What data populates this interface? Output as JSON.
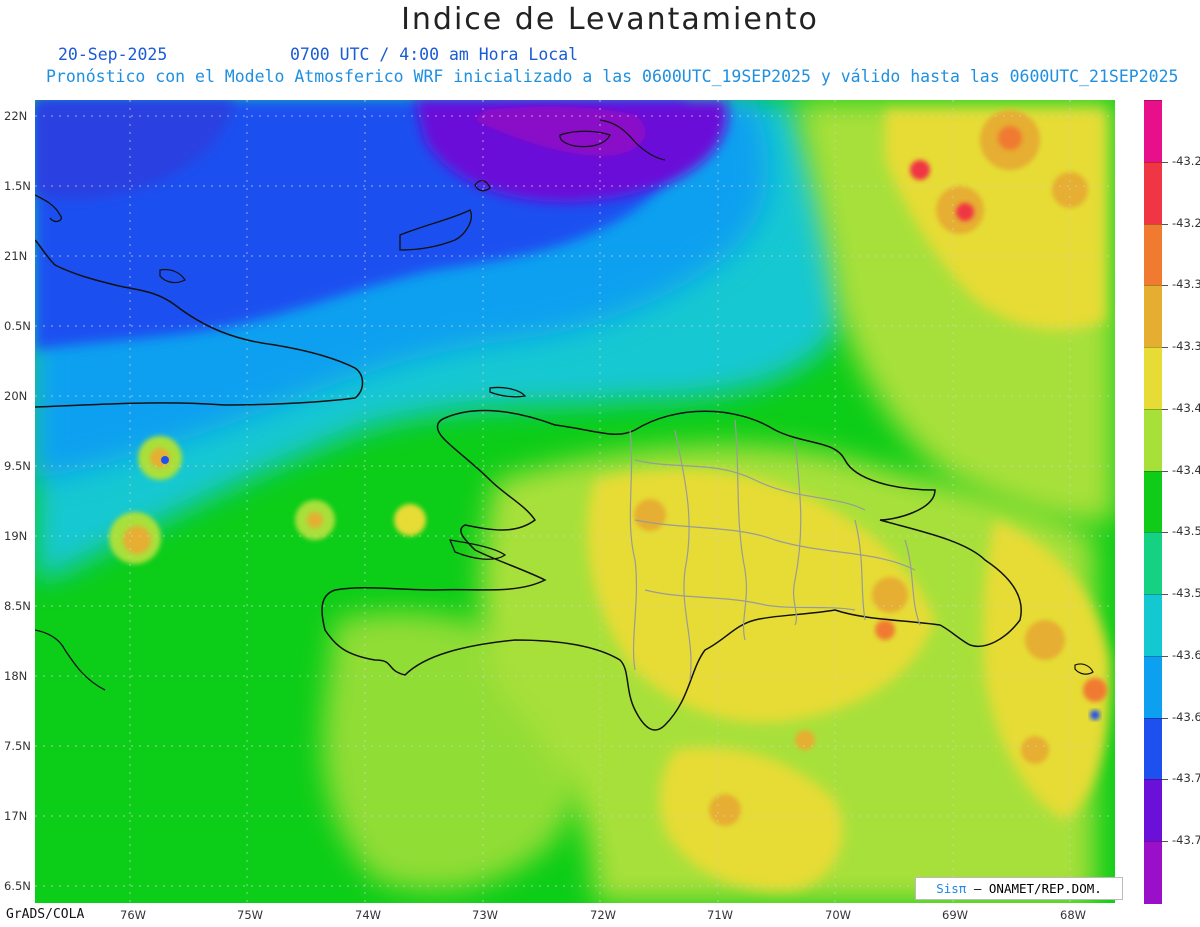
{
  "header": {
    "title": "Indice de Levantamiento",
    "date": "20-Sep-2025",
    "time": "0700 UTC / 4:00 am Hora Local",
    "model_line": "Pronóstico con el Modelo Atmosferico WRF inicializado a las 0600UTC_19SEP2025 y válido hasta las  0600UTC_21SEP2025"
  },
  "map": {
    "lat_labels": [
      "22N",
      "1.5N",
      "21N",
      "0.5N",
      "20N",
      "9.5N",
      "19N",
      "8.5N",
      "18N",
      "7.5N",
      "17N",
      "6.5N"
    ],
    "lon_labels": [
      "76W",
      "75W",
      "74W",
      "73W",
      "72W",
      "71W",
      "70W",
      "69W",
      "68W"
    ],
    "colors": {
      "background_field": "#0ccd18",
      "coastline": "#111111",
      "province_borders": "#9a9a9a",
      "gridlines": "#c8c8c8"
    }
  },
  "colorbar": {
    "labels": [
      "-43.2",
      "-43.2",
      "-43.3",
      "-43.3",
      "-43.4",
      "-43.4",
      "-43.5",
      "-43.5",
      "-43.6",
      "-43.6",
      "-43.7",
      "-43.7"
    ],
    "colors": [
      "#e8108a",
      "#f03545",
      "#f07a30",
      "#e6ae30",
      "#e6dc35",
      "#a8e03a",
      "#10cc18",
      "#14d282",
      "#14c8d2",
      "#0ea0f0",
      "#1e50f0",
      "#6a10d8",
      "#9a10c8"
    ]
  },
  "credit": {
    "sis": "Sisπ",
    "rest": " – ONAMET/REP.DOM."
  },
  "footer": {
    "software": "GrADS/COLA"
  }
}
